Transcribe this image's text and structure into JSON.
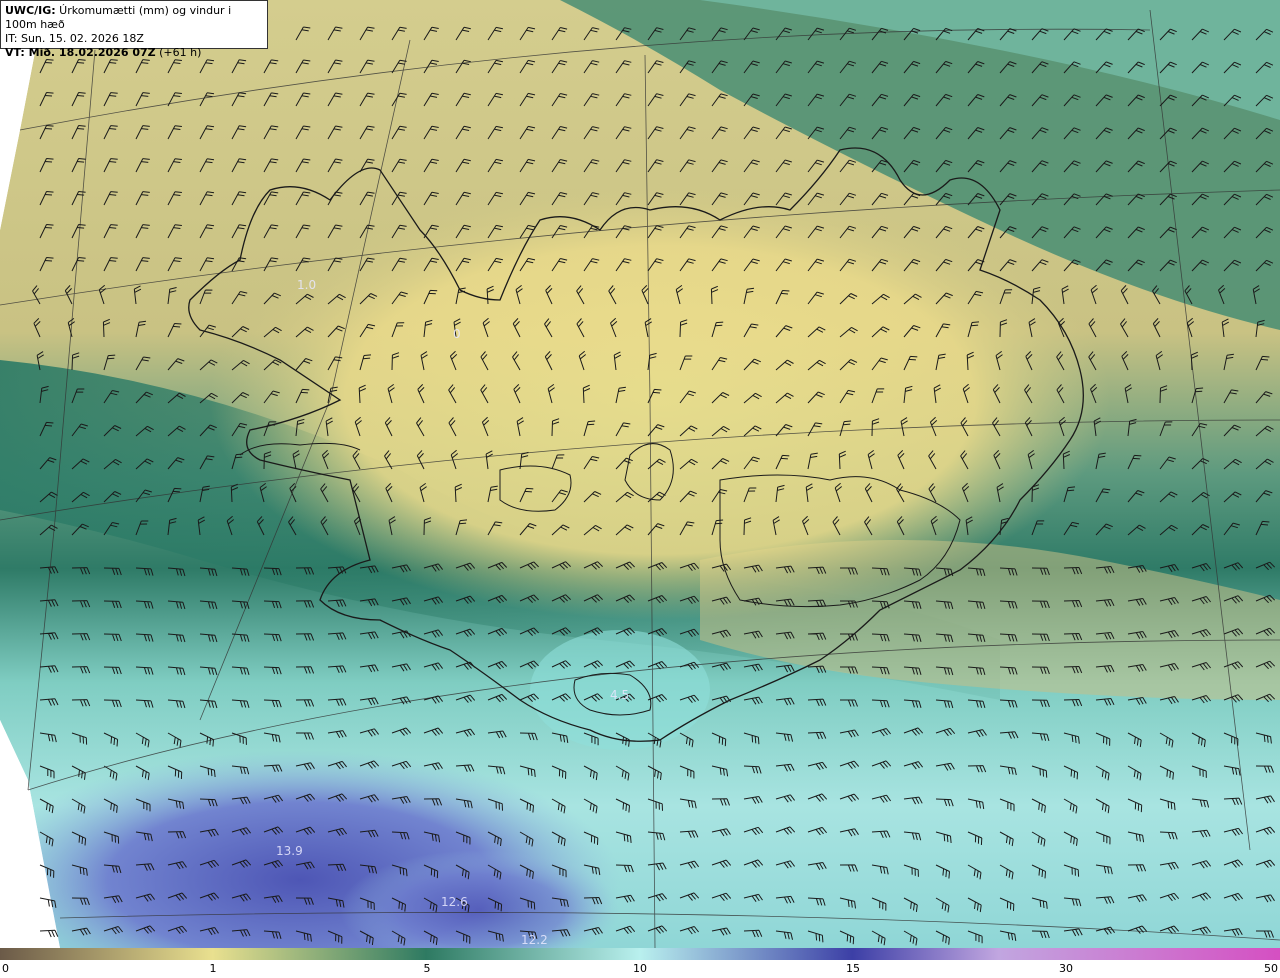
{
  "header": {
    "product": "UWC/IG:",
    "title": " Úrkomumætti (mm) og vindur i 100m hæð",
    "issue_time": "IT: Sun. 15. 02. 2026 18Z",
    "valid_prefix": "VT: Mið. 18.02.2026 07Z",
    "valid_suffix": " (+61 h)"
  },
  "value_labels": [
    {
      "text": "1.0",
      "id": "label-1-0"
    },
    {
      "text": "0",
      "id": "label-0-west"
    },
    {
      "text": "4.5",
      "id": "label-4-5"
    },
    {
      "text": "13.9",
      "id": "label-13-9"
    },
    {
      "text": "12.6",
      "id": "label-12-6"
    },
    {
      "text": "12.2",
      "id": "label-12-2"
    }
  ],
  "colorbar": {
    "ticks": [
      "0",
      "1",
      "5",
      "10",
      "15",
      "30",
      "50"
    ],
    "colors": {
      "dry": "#6b5a48",
      "low": "#e9e08f",
      "mid": "#2e7a62",
      "high": "#b9f0ee",
      "heavy": "#3c3fa6",
      "extreme": "#d54fc2"
    }
  }
}
